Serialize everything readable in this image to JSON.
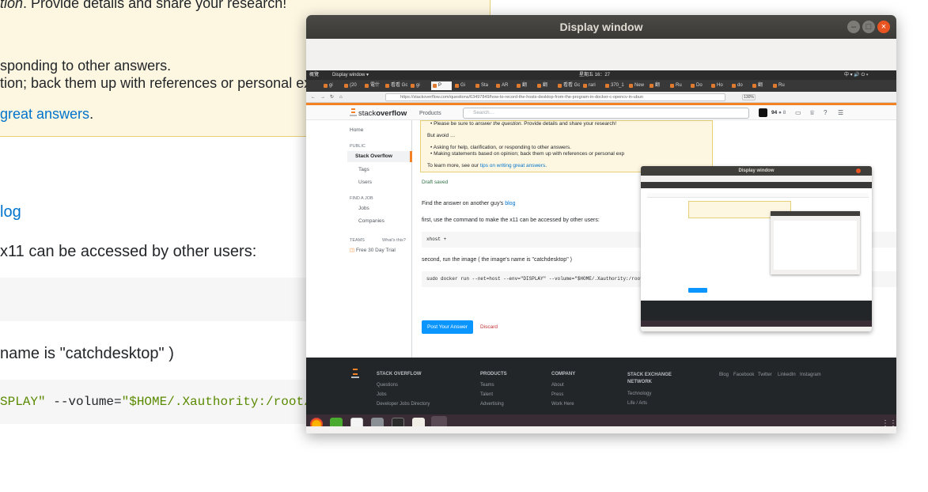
{
  "background": {
    "line1_italic": "tion",
    "line1_rest": ". Provide details and share your research!",
    "line2": "sponding to other answers.",
    "line3": "tion; back them up with references or personal exp",
    "line4_link": "great answers",
    "line4_rest": ".",
    "blog_link": "log",
    "x11_text": "x11 can be accessed by other users:",
    "image_text": "name is \"catchdesktop\" )",
    "code_part1": "SPLAY\"",
    "code_part2": " --volume=",
    "code_part3": "\"$HOME/.Xauthority:/root/.Xauth"
  },
  "window": {
    "title": "Display window",
    "min_glyph": "–",
    "max_glyph": "□",
    "close_glyph": "×"
  },
  "inner": {
    "topbar_left": "概覽",
    "topbar_app": "Display window ▾",
    "topbar_clock": "星期五 16：27",
    "topbar_right": "中 ▾   🔊  ⏻ ▾",
    "tabs": [
      "gi",
      "(20",
      "電什",
      "看看 Go",
      "gi",
      "P",
      "Gi",
      "Sta",
      "AR",
      "翻",
      "翻",
      "看看 Go",
      "rari",
      "370_1",
      "New",
      "翻",
      "Ru",
      "Do",
      "Ho",
      "do",
      "翻",
      "Ru"
    ],
    "url": "https://stackoverflow.com/questions/63497849/how-to-record-the-hosts-desktop-from-the-program-in-docker-c-opencv-in-ubun",
    "zoom": "130%",
    "logo_plain": "stack",
    "logo_bold": "overflow",
    "products": "Products",
    "search_placeholder": "Search…",
    "rep": "94",
    "rep_badge": "● 8",
    "sidebar": {
      "home": "Home",
      "public": "PUBLIC",
      "stack_overflow": "Stack Overflow",
      "tags": "Tags",
      "users": "Users",
      "find_job": "FIND A JOB",
      "jobs": "Jobs",
      "companies": "Companies",
      "teams": "TEAMS",
      "whats_this": "What's this?",
      "free_trial": "Free 30 Day Trial"
    },
    "main": {
      "bullet1_pre": "Please be sure to ",
      "bullet1_em": "answer the question",
      "bullet1_post": ". Provide details and share your research!",
      "but_avoid": "But avoid …",
      "bullet2": "Asking for help, clarification, or responding to other answers.",
      "bullet3": "Making statements based on opinion; back them up with references or personal exp",
      "learn_pre": "To learn more, see our ",
      "learn_link": "tips on writing great answers",
      "learn_post": ".",
      "draft_saved": "Draft saved",
      "find_answer_pre": "Find the answer on another guy's ",
      "find_answer_link": "blog",
      "first_use": "first, use the command to make the x11 can be accessed by other users:",
      "code1": "xhost +",
      "second_run": "second, run the image ( the image's name is \"catchdesktop\" )",
      "code2": "sudo docker run --net=host --env=\"DISPLAY\" --volume=\"$HOME/.Xauthority:/root/.Xauth",
      "post_button": "Post Your Answer",
      "discard": "Discard"
    },
    "footer": {
      "col1_title": "STACK OVERFLOW",
      "col1_items": [
        "Questions",
        "Jobs",
        "Developer Jobs Directory"
      ],
      "col2_title": "PRODUCTS",
      "col2_items": [
        "Teams",
        "Talent",
        "Advertising"
      ],
      "col3_title": "COMPANY",
      "col3_items": [
        "About",
        "Press",
        "Work Here"
      ],
      "col4_title": "STACK EXCHANGE NETWORK",
      "col4_items": [
        "Technology",
        "Life / Arts"
      ],
      "social": [
        "Blog",
        "Facebook",
        "Twitter",
        "LinkedIn",
        "Instagram"
      ]
    },
    "thumb_title": "Display window"
  }
}
